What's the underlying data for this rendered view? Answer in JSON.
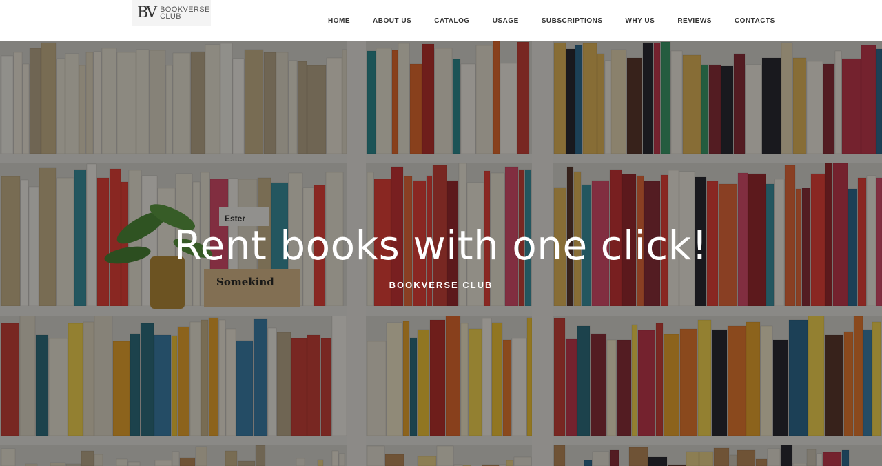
{
  "header": {
    "logo": {
      "mark": "BV",
      "line1": "BOOKVERSE",
      "line2": "CLUB"
    },
    "nav": [
      {
        "label": "HOME"
      },
      {
        "label": "ABOUT US"
      },
      {
        "label": "CATALOG"
      },
      {
        "label": "USAGE"
      },
      {
        "label": "SUBSCRIPTIONS"
      },
      {
        "label": "WHY US"
      },
      {
        "label": "REVIEWS"
      },
      {
        "label": "CONTACTS"
      }
    ]
  },
  "hero": {
    "title": "Rent books with one click!",
    "subtitle": "BOOKVERSE CLUB",
    "background": "bookshelf-photo",
    "signs": {
      "sign1": "Ester",
      "sign2": "Somekind"
    }
  },
  "colors": {
    "overlay": "#000000",
    "nav_text": "#333333",
    "hero_text": "#ffffff",
    "shelf": "#e6e4df"
  }
}
